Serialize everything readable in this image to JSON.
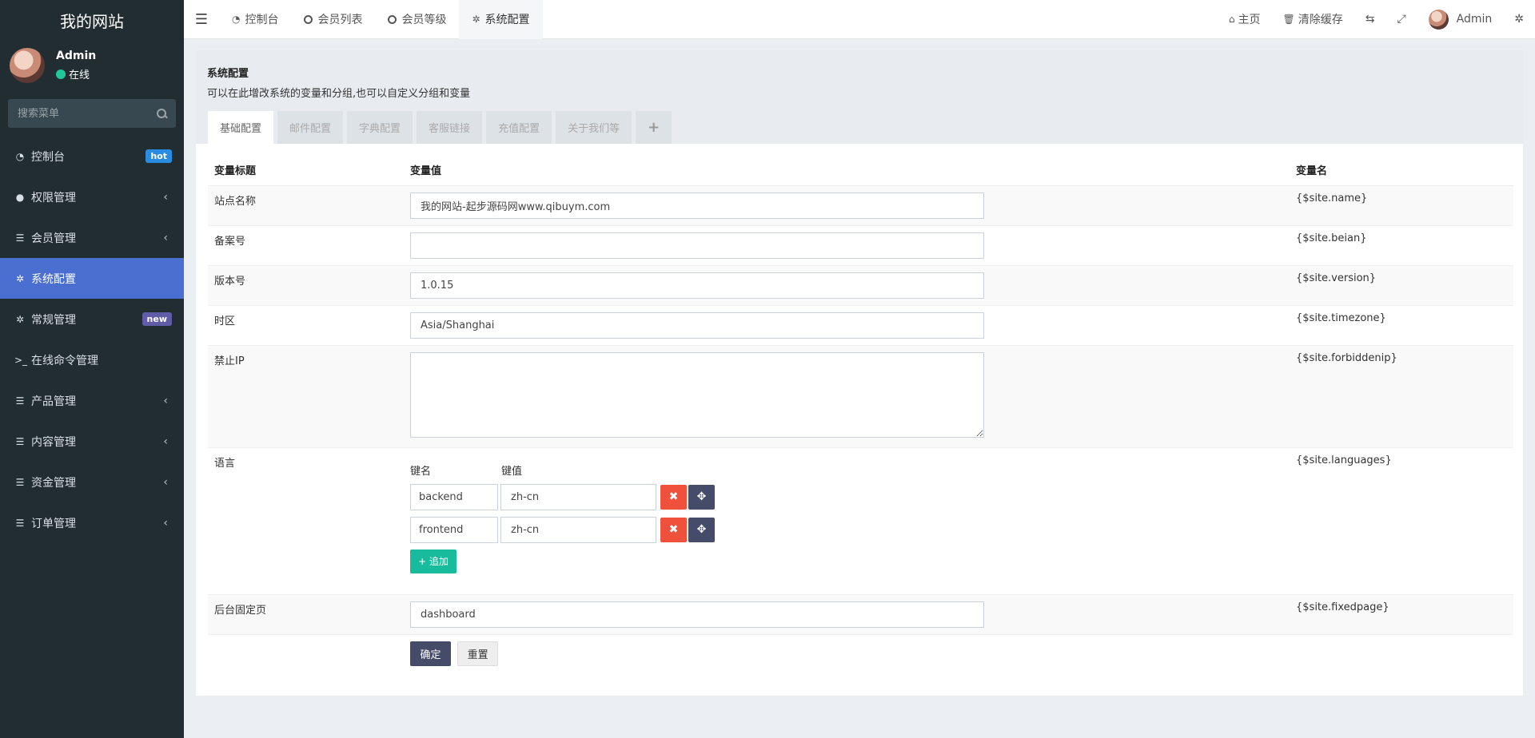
{
  "sidebar": {
    "site_title": "我的网站",
    "user": {
      "name": "Admin",
      "status": "在线"
    },
    "search_placeholder": "搜索菜单",
    "items": [
      {
        "label": "控制台",
        "icon": "dashboard-icon",
        "badge": "hot"
      },
      {
        "label": "权限管理",
        "icon": "users-icon"
      },
      {
        "label": "会员管理",
        "icon": "list-icon"
      },
      {
        "label": "系统配置",
        "icon": "gear-icon"
      },
      {
        "label": "常规管理",
        "icon": "gears-icon",
        "badge": "new"
      },
      {
        "label": "在线命令管理",
        "icon": "terminal-icon"
      },
      {
        "label": "产品管理",
        "icon": "list-icon"
      },
      {
        "label": "内容管理",
        "icon": "list-icon"
      },
      {
        "label": "资金管理",
        "icon": "list-icon"
      },
      {
        "label": "订单管理",
        "icon": "list-icon"
      }
    ]
  },
  "topbar": {
    "tabs": [
      {
        "label": "控制台",
        "icon": "dashboard-icon"
      },
      {
        "label": "会员列表",
        "icon": "circle-icon"
      },
      {
        "label": "会员等级",
        "icon": "circle-icon"
      },
      {
        "label": "系统配置",
        "icon": "gear-icon"
      }
    ],
    "right": {
      "home": "主页",
      "clear_cache": "清除缓存",
      "username": "Admin"
    }
  },
  "page": {
    "title": "系统配置",
    "description": "可以在此增改系统的变量和分组,也可以自定义分组和变量",
    "tabs": [
      "基础配置",
      "邮件配置",
      "字典配置",
      "客服链接",
      "充值配置",
      "关于我们等"
    ],
    "table_headers": {
      "title": "变量标题",
      "value": "变量值",
      "name": "变量名"
    },
    "rows": {
      "site_name": {
        "title": "站点名称",
        "value": "我的网站-起步源码网www.qibuym.com",
        "var": "{$site.name}"
      },
      "beian": {
        "title": "备案号",
        "value": "",
        "var": "{$site.beian}"
      },
      "version": {
        "title": "版本号",
        "value": "1.0.15",
        "var": "{$site.version}"
      },
      "timezone": {
        "title": "时区",
        "value": "Asia/Shanghai",
        "var": "{$site.timezone}"
      },
      "forbiddenip": {
        "title": "禁止IP",
        "value": "",
        "var": "{$site.forbiddenip}"
      },
      "languages": {
        "title": "语言",
        "var": "{$site.languages}",
        "key_header": "键名",
        "val_header": "键值",
        "pairs": [
          {
            "key": "backend",
            "value": "zh-cn"
          },
          {
            "key": "frontend",
            "value": "zh-cn"
          }
        ],
        "add_label": "+ 追加"
      },
      "fixedpage": {
        "title": "后台固定页",
        "value": "dashboard",
        "var": "{$site.fixedpage}"
      }
    },
    "buttons": {
      "submit": "确定",
      "reset": "重置"
    }
  }
}
